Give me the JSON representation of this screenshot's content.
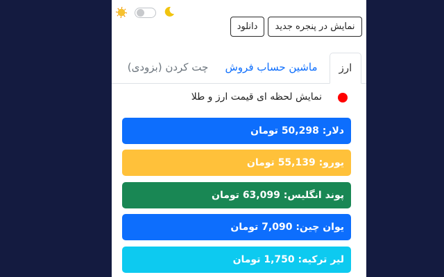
{
  "theme": {
    "sun_icon": "sun-icon",
    "moon_icon": "moon-icon",
    "dark_mode_on": false
  },
  "toolbar": {
    "download_label": "دانلود",
    "new_window_label": "نمایش در پنجره جدید"
  },
  "tabs": [
    {
      "label": "ارز",
      "active": true
    },
    {
      "label": "ماشین حساب فروش",
      "active": false
    },
    {
      "label": "چت کردن (بزودی)",
      "active": false
    }
  ],
  "live": {
    "indicator_color": "#ff0000",
    "text": "نمایش لحظه ای قیمت ارز و طلا"
  },
  "rates": [
    {
      "text": "دلار: 50,298 تومان",
      "color": "#0d6efd"
    },
    {
      "text": "یورو: 55,139 تومان",
      "color": "#ffc13a"
    },
    {
      "text": "پوند انگلیس: 63,099 تومان",
      "color": "#198754"
    },
    {
      "text": "یوان چین: 7,090 تومان",
      "color": "#0d6efd"
    },
    {
      "text": "لیر ترکیه: 1,750 تومان",
      "color": "#0dcaf0"
    }
  ]
}
